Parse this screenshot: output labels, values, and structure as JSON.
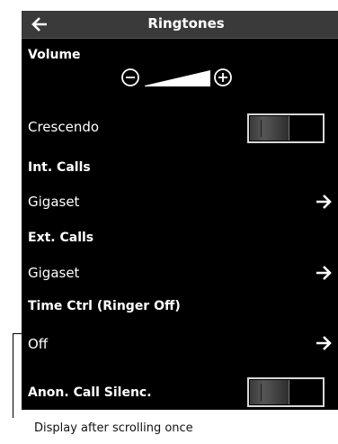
{
  "header": {
    "title": "Ringtones",
    "back_icon": "arrow-left-icon"
  },
  "volume": {
    "label": "Volume",
    "decrease_icon": "minus-circle-icon",
    "increase_icon": "plus-circle-icon",
    "level": 0.75
  },
  "crescendo": {
    "label": "Crescendo",
    "state": "off"
  },
  "int_calls": {
    "label": "Int. Calls",
    "value": "Gigaset",
    "action_icon": "arrow-right-icon"
  },
  "ext_calls": {
    "label": "Ext. Calls",
    "value": "Gigaset",
    "action_icon": "arrow-right-icon"
  },
  "time_ctrl": {
    "label": "Time Ctrl (Ringer Off)",
    "value": "Off",
    "action_icon": "arrow-right-icon"
  },
  "anon_call": {
    "label": "Anon. Call Silenc.",
    "state": "off"
  },
  "caption": "Display after scrolling once"
}
